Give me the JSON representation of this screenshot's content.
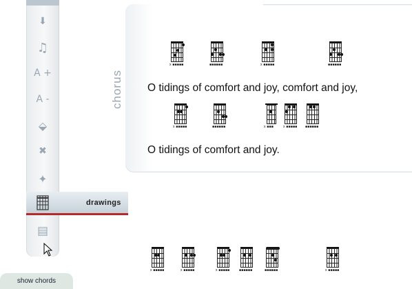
{
  "toolbar": {
    "tools": [
      {
        "name": "download-icon",
        "glyph": "⬇"
      },
      {
        "name": "music-note-icon",
        "glyph": "♫"
      },
      {
        "name": "font-increase-icon",
        "glyph": "A +"
      },
      {
        "name": "font-decrease-icon",
        "glyph": "A -"
      },
      {
        "name": "paint-bucket-icon",
        "glyph": "⬙"
      },
      {
        "name": "close-icon",
        "glyph": "✖"
      },
      {
        "name": "sparkle-icon",
        "glyph": "✦"
      },
      {
        "name": "page-icon",
        "glyph": "▤"
      }
    ],
    "drawings_label": "drawings",
    "show_chords_label": "show chords"
  },
  "section": {
    "label": "chorus",
    "lines": [
      "O tidings of comfort and joy, comfort and joy,",
      "O tidings of comfort and joy."
    ]
  }
}
